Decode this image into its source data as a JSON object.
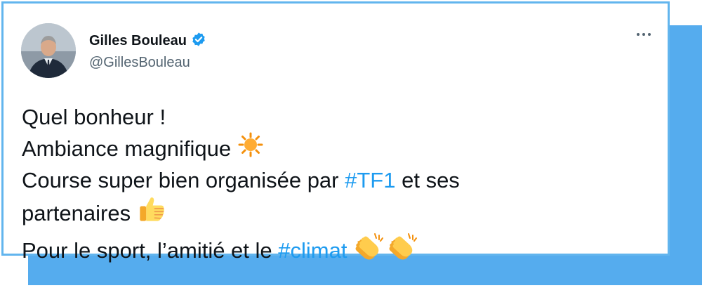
{
  "user": {
    "name": "Gilles Bouleau",
    "handle": "@GillesBouleau",
    "verified": true
  },
  "tweet": {
    "line1": "Quel bonheur !",
    "line2": "Ambiance magnifique",
    "line3_pre": "Course super bien organisée par ",
    "line3_tag": "#TF1",
    "line3_post": " et ses",
    "line4": "partenaires",
    "line5_pre": "Pour le sport, l’amitié et le ",
    "line5_tag": "#climat"
  },
  "emojis": {
    "line2": "sun-emoji",
    "line4": "thumbs-up-emoji",
    "line5": [
      "clapping-hands-emoji",
      "clapping-hands-emoji"
    ]
  },
  "colors": {
    "accent": "#55acee",
    "hashtag": "#1d9bf0",
    "verified": "#1d9bf0"
  }
}
